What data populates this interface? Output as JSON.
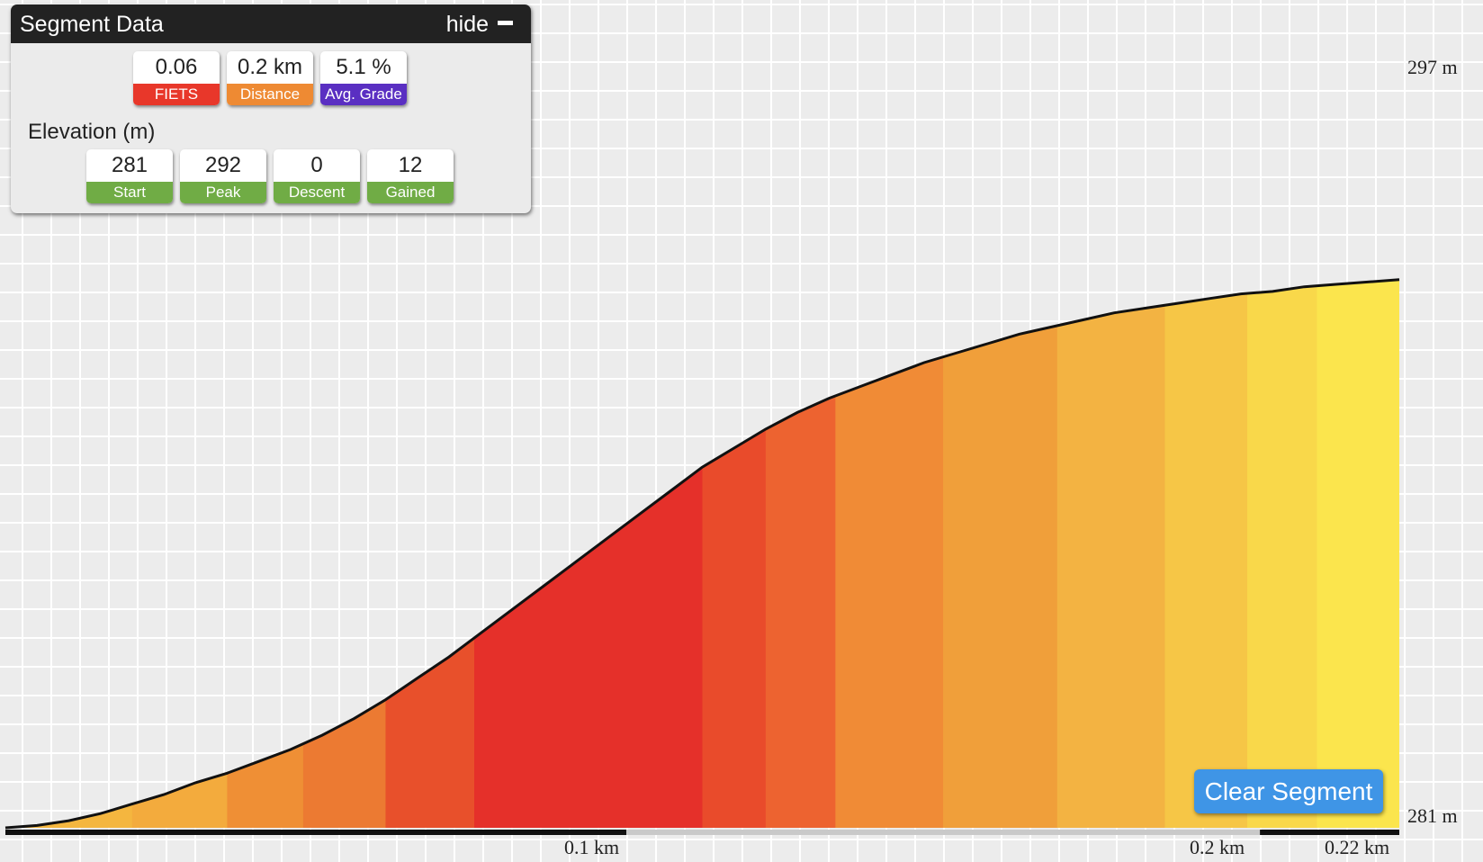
{
  "segment_panel": {
    "title": "Segment Data",
    "hide_label": "hide",
    "hide_icon": "minus-icon",
    "stats": [
      {
        "value": "0.06",
        "label": "FIETS",
        "color": "#e8372a"
      },
      {
        "value": "0.2 km",
        "label": "Distance",
        "color": "#ee8a33"
      },
      {
        "value": "5.1 %",
        "label": "Avg. Grade",
        "color": "#5a2fc2"
      }
    ],
    "elevation_heading": "Elevation (m)",
    "elevation_stats": [
      {
        "value": "281",
        "label": "Start",
        "color": "#70ac45"
      },
      {
        "value": "292",
        "label": "Peak",
        "color": "#70ac45"
      },
      {
        "value": "0",
        "label": "Descent",
        "color": "#70ac45"
      },
      {
        "value": "12",
        "label": "Gained",
        "color": "#70ac45"
      }
    ]
  },
  "clear_segment_label": "Clear Segment",
  "chart_data": {
    "type": "area",
    "x_unit": "km",
    "y_unit": "m",
    "ylim": [
      281,
      297
    ],
    "y_tick_labels": [
      "297 m",
      "281 m"
    ],
    "x_tick_labels": [
      "0.1 km",
      "0.2 km",
      "0.22 km"
    ],
    "x_ticks": [
      0.1,
      0.2,
      0.22
    ],
    "xlim": [
      0,
      0.22
    ],
    "grid": true,
    "x": [
      0.0,
      0.005,
      0.01,
      0.015,
      0.02,
      0.025,
      0.03,
      0.035,
      0.04,
      0.045,
      0.05,
      0.055,
      0.06,
      0.065,
      0.07,
      0.075,
      0.08,
      0.085,
      0.09,
      0.095,
      0.1,
      0.105,
      0.11,
      0.115,
      0.12,
      0.125,
      0.13,
      0.135,
      0.14,
      0.145,
      0.15,
      0.155,
      0.16,
      0.165,
      0.17,
      0.175,
      0.18,
      0.185,
      0.19,
      0.195,
      0.2,
      0.205,
      0.21,
      0.215,
      0.22
    ],
    "y": [
      281.0,
      281.05,
      281.15,
      281.3,
      281.5,
      281.7,
      281.95,
      282.15,
      282.4,
      282.65,
      282.95,
      283.3,
      283.7,
      284.15,
      284.6,
      285.1,
      285.6,
      286.1,
      286.6,
      287.1,
      287.6,
      288.1,
      288.6,
      289.0,
      289.4,
      289.75,
      290.05,
      290.3,
      290.55,
      290.8,
      291.0,
      291.2,
      291.4,
      291.55,
      291.7,
      291.85,
      291.95,
      292.05,
      292.15,
      292.25,
      292.3,
      292.4,
      292.45,
      292.5,
      292.55
    ],
    "grade_color_bands": [
      {
        "from": 0.0,
        "to": 0.02,
        "color": "#f4b63f"
      },
      {
        "from": 0.02,
        "to": 0.035,
        "color": "#f3ab3d"
      },
      {
        "from": 0.035,
        "to": 0.047,
        "color": "#ef8f35"
      },
      {
        "from": 0.047,
        "to": 0.06,
        "color": "#ec7a32"
      },
      {
        "from": 0.06,
        "to": 0.074,
        "color": "#e8502b"
      },
      {
        "from": 0.074,
        "to": 0.11,
        "color": "#e5302a"
      },
      {
        "from": 0.11,
        "to": 0.12,
        "color": "#e94b2b"
      },
      {
        "from": 0.12,
        "to": 0.131,
        "color": "#ed6330"
      },
      {
        "from": 0.131,
        "to": 0.148,
        "color": "#f08b36"
      },
      {
        "from": 0.148,
        "to": 0.166,
        "color": "#f09f3a"
      },
      {
        "from": 0.166,
        "to": 0.183,
        "color": "#f3b342"
      },
      {
        "from": 0.183,
        "to": 0.196,
        "color": "#f6c646"
      },
      {
        "from": 0.196,
        "to": 0.207,
        "color": "#f9d84a"
      },
      {
        "from": 0.207,
        "to": 0.22,
        "color": "#fbe54d"
      }
    ],
    "segment_bar": [
      {
        "from": 0.0,
        "to": 0.098,
        "color": "#111111"
      },
      {
        "from": 0.098,
        "to": 0.198,
        "color": "#c9c9c9"
      },
      {
        "from": 0.198,
        "to": 0.22,
        "color": "#111111"
      }
    ]
  }
}
